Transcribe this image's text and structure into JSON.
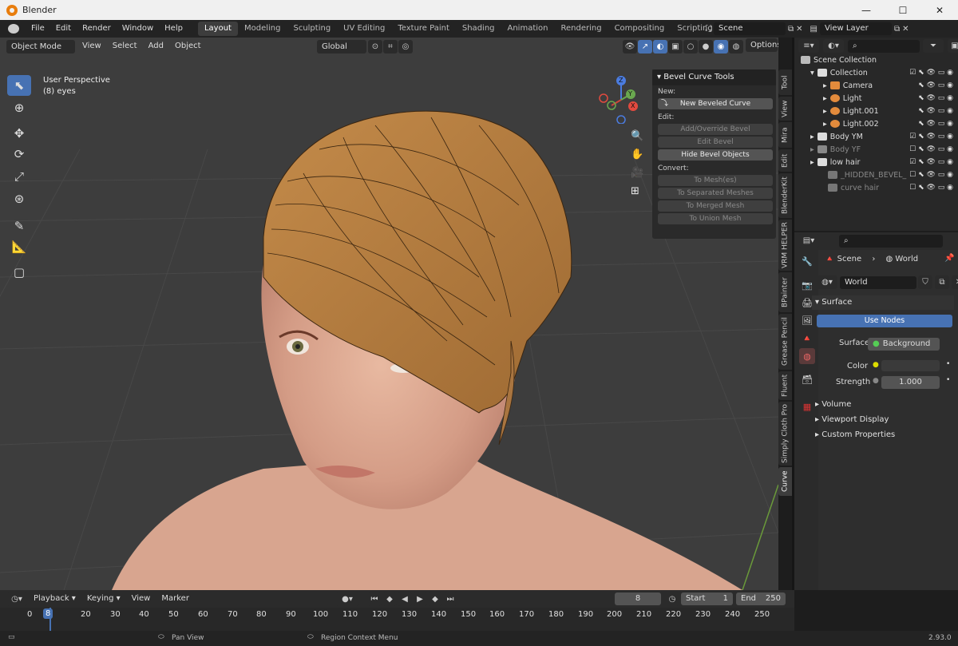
{
  "window": {
    "title": "Blender",
    "min": "—",
    "max": "☐",
    "close": "✕"
  },
  "menu": [
    "File",
    "Edit",
    "Render",
    "Window",
    "Help"
  ],
  "workspaces": [
    "Layout",
    "Modeling",
    "Sculpting",
    "UV Editing",
    "Texture Paint",
    "Shading",
    "Animation",
    "Rendering",
    "Compositing",
    "Scripting"
  ],
  "workspace_add": "+",
  "scene": {
    "scene_name": "Scene",
    "view_layer": "View Layer"
  },
  "viewport": {
    "mode": "Object Mode",
    "menus": [
      "View",
      "Select",
      "Add",
      "Object"
    ],
    "transform": "Global",
    "options": "Options",
    "overlay_line1": "User Perspective",
    "overlay_line2": "(8) eyes",
    "gizmo_x": "X",
    "gizmo_y": "Y",
    "gizmo_z": "Z"
  },
  "npanel": {
    "title": "Bevel Curve Tools",
    "new_label": "New:",
    "new_btn": "New Beveled Curve",
    "edit_label": "Edit:",
    "edit_btns": [
      "Add/Override Bevel",
      "Edit Bevel",
      "Hide Bevel Objects"
    ],
    "convert_label": "Convert:",
    "convert_btns": [
      "To Mesh(es)",
      "To Separated Meshes",
      "To Merged Mesh",
      "To Union Mesh"
    ]
  },
  "vtabs": [
    "Tool",
    "View",
    "Mira",
    "Edit",
    "BlenderKit",
    "VRM HELPER",
    "BPainter",
    "Grease Pencil",
    "Fluent",
    "Simply Cloth Pro",
    "Curve"
  ],
  "outliner": {
    "rows": [
      {
        "label": "Scene Collection"
      },
      {
        "label": "Collection"
      },
      {
        "label": "Camera"
      },
      {
        "label": "Light"
      },
      {
        "label": "Light.001"
      },
      {
        "label": "Light.002"
      },
      {
        "label": "Body YM"
      },
      {
        "label": "Body YF"
      },
      {
        "label": "low hair"
      },
      {
        "label": "_HIDDEN_BEVEL_"
      },
      {
        "label": "curve hair"
      }
    ]
  },
  "properties": {
    "scene_tab": "Scene",
    "world_tab": "World",
    "world_name": "World",
    "surface_panel": "Surface",
    "use_nodes": "Use Nodes",
    "surface_label": "Surface",
    "surface_value": "Background",
    "color_label": "Color",
    "strength_label": "Strength",
    "strength_value": "1.000",
    "subpanels": [
      "Volume",
      "Viewport Display",
      "Custom Properties"
    ]
  },
  "timeline": {
    "menus": [
      "Playback",
      "Keying",
      "View",
      "Marker"
    ],
    "current_frame": "8",
    "start_label": "Start",
    "start": "1",
    "end_label": "End",
    "end": "250",
    "ticks": [
      "0",
      "8",
      "20",
      "30",
      "40",
      "50",
      "60",
      "70",
      "80",
      "90",
      "100",
      "110",
      "120",
      "130",
      "140",
      "150",
      "160",
      "170",
      "180",
      "190",
      "200",
      "210",
      "220",
      "230",
      "240",
      "250"
    ]
  },
  "status": {
    "pan": "Pan View",
    "context": "Region Context Menu",
    "version": "2.93.0"
  }
}
